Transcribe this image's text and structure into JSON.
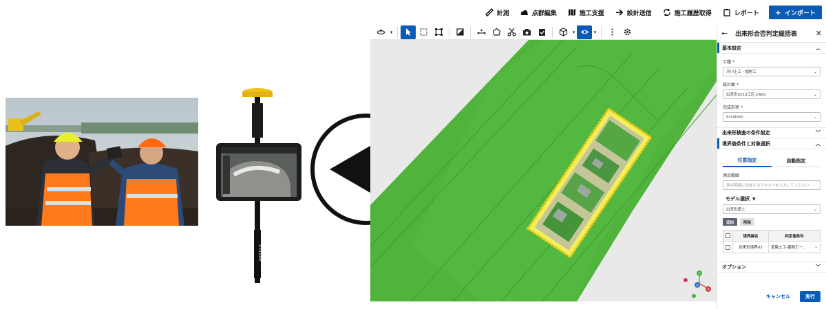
{
  "menubar": {
    "items": [
      {
        "label": "計測",
        "icon": "ruler-icon"
      },
      {
        "label": "点群編集",
        "icon": "cloud-icon"
      },
      {
        "label": "施工支援",
        "icon": "map-icon"
      },
      {
        "label": "設計送信",
        "icon": "arrow-right-icon"
      },
      {
        "label": "施工履歴取得",
        "icon": "sync-icon"
      },
      {
        "label": "レポート",
        "icon": "clipboard-icon"
      }
    ],
    "import_label": "インポート"
  },
  "panel": {
    "title": "出来形合否判定総括表",
    "sections": {
      "basic": "基本設定",
      "inspection": "出来形検査の条件設定",
      "boundary": "境界値条件と対象選択",
      "options": "オプション"
    },
    "fields": {
      "work_type_label": "工種",
      "work_type_value": "河川土工・掘削工",
      "design_label": "設計面",
      "design_value": "出来形0213工区.DWG",
      "shape_label": "完成形状",
      "shape_value": "dcsglobo"
    },
    "tabs": [
      "任意指定",
      "自動指定"
    ],
    "range_label": "測点範囲",
    "range_placeholder": "測点範囲に追加するテキストを入力してください",
    "model_label": "モデル選択",
    "model_value": "出来形盛土",
    "chip_add": "追加",
    "chip_delete": "削除",
    "table": {
      "headers": [
        "境界線名",
        "判定値条件"
      ],
      "rows": [
        {
          "name": "出来形境界01",
          "cond": "道路土工-掘削工一…"
        }
      ]
    },
    "cancel_label": "キャンセル",
    "run_label": "実行"
  },
  "colors": {
    "accent": "#0a5bb5",
    "terrain": "#4caf3a"
  }
}
